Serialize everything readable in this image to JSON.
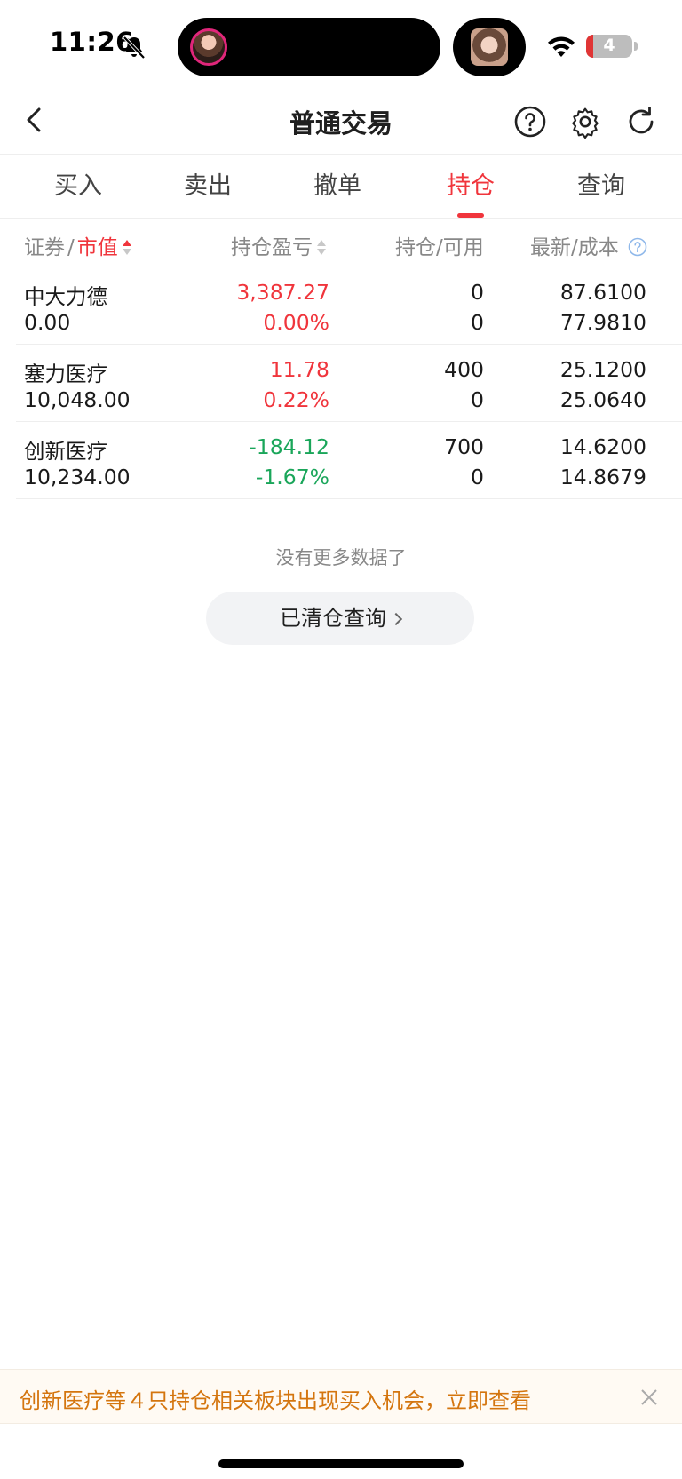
{
  "status_bar": {
    "time": "11:26",
    "battery": "4"
  },
  "nav": {
    "title": "普通交易"
  },
  "tabs": [
    {
      "label": "买入"
    },
    {
      "label": "卖出"
    },
    {
      "label": "撤单"
    },
    {
      "label": "持仓",
      "active": true
    },
    {
      "label": "查询"
    }
  ],
  "table_header": {
    "col1_a": "证券",
    "col1_sep": "/",
    "col1_b": "市值",
    "col2": "持仓盈亏",
    "col3": "持仓/可用",
    "col4": "最新/成本"
  },
  "rows": [
    {
      "name": "中大力德",
      "market_value": "0.00",
      "pl": "3,387.27",
      "pl_pct": "0.00%",
      "pl_color": "red",
      "qty": "0",
      "avail": "0",
      "latest": "87.6100",
      "cost": "77.9810"
    },
    {
      "name": "塞力医疗",
      "market_value": "10,048.00",
      "pl": "11.78",
      "pl_pct": "0.22%",
      "pl_color": "red",
      "qty": "400",
      "avail": "0",
      "latest": "25.1200",
      "cost": "25.0640"
    },
    {
      "name": "创新医疗",
      "market_value": "10,234.00",
      "pl": "-184.12",
      "pl_pct": "-1.67%",
      "pl_color": "green",
      "qty": "700",
      "avail": "0",
      "latest": "14.6200",
      "cost": "14.8679"
    }
  ],
  "no_more_text": "没有更多数据了",
  "cleared_button": "已清仓查询",
  "notice": "创新医疗等４只持仓相关板块出现买入机会，立即查看",
  "colors": {
    "accent_red": "#f0353c",
    "gain_green": "#1aa65a",
    "notice_orange": "#d4750e"
  }
}
